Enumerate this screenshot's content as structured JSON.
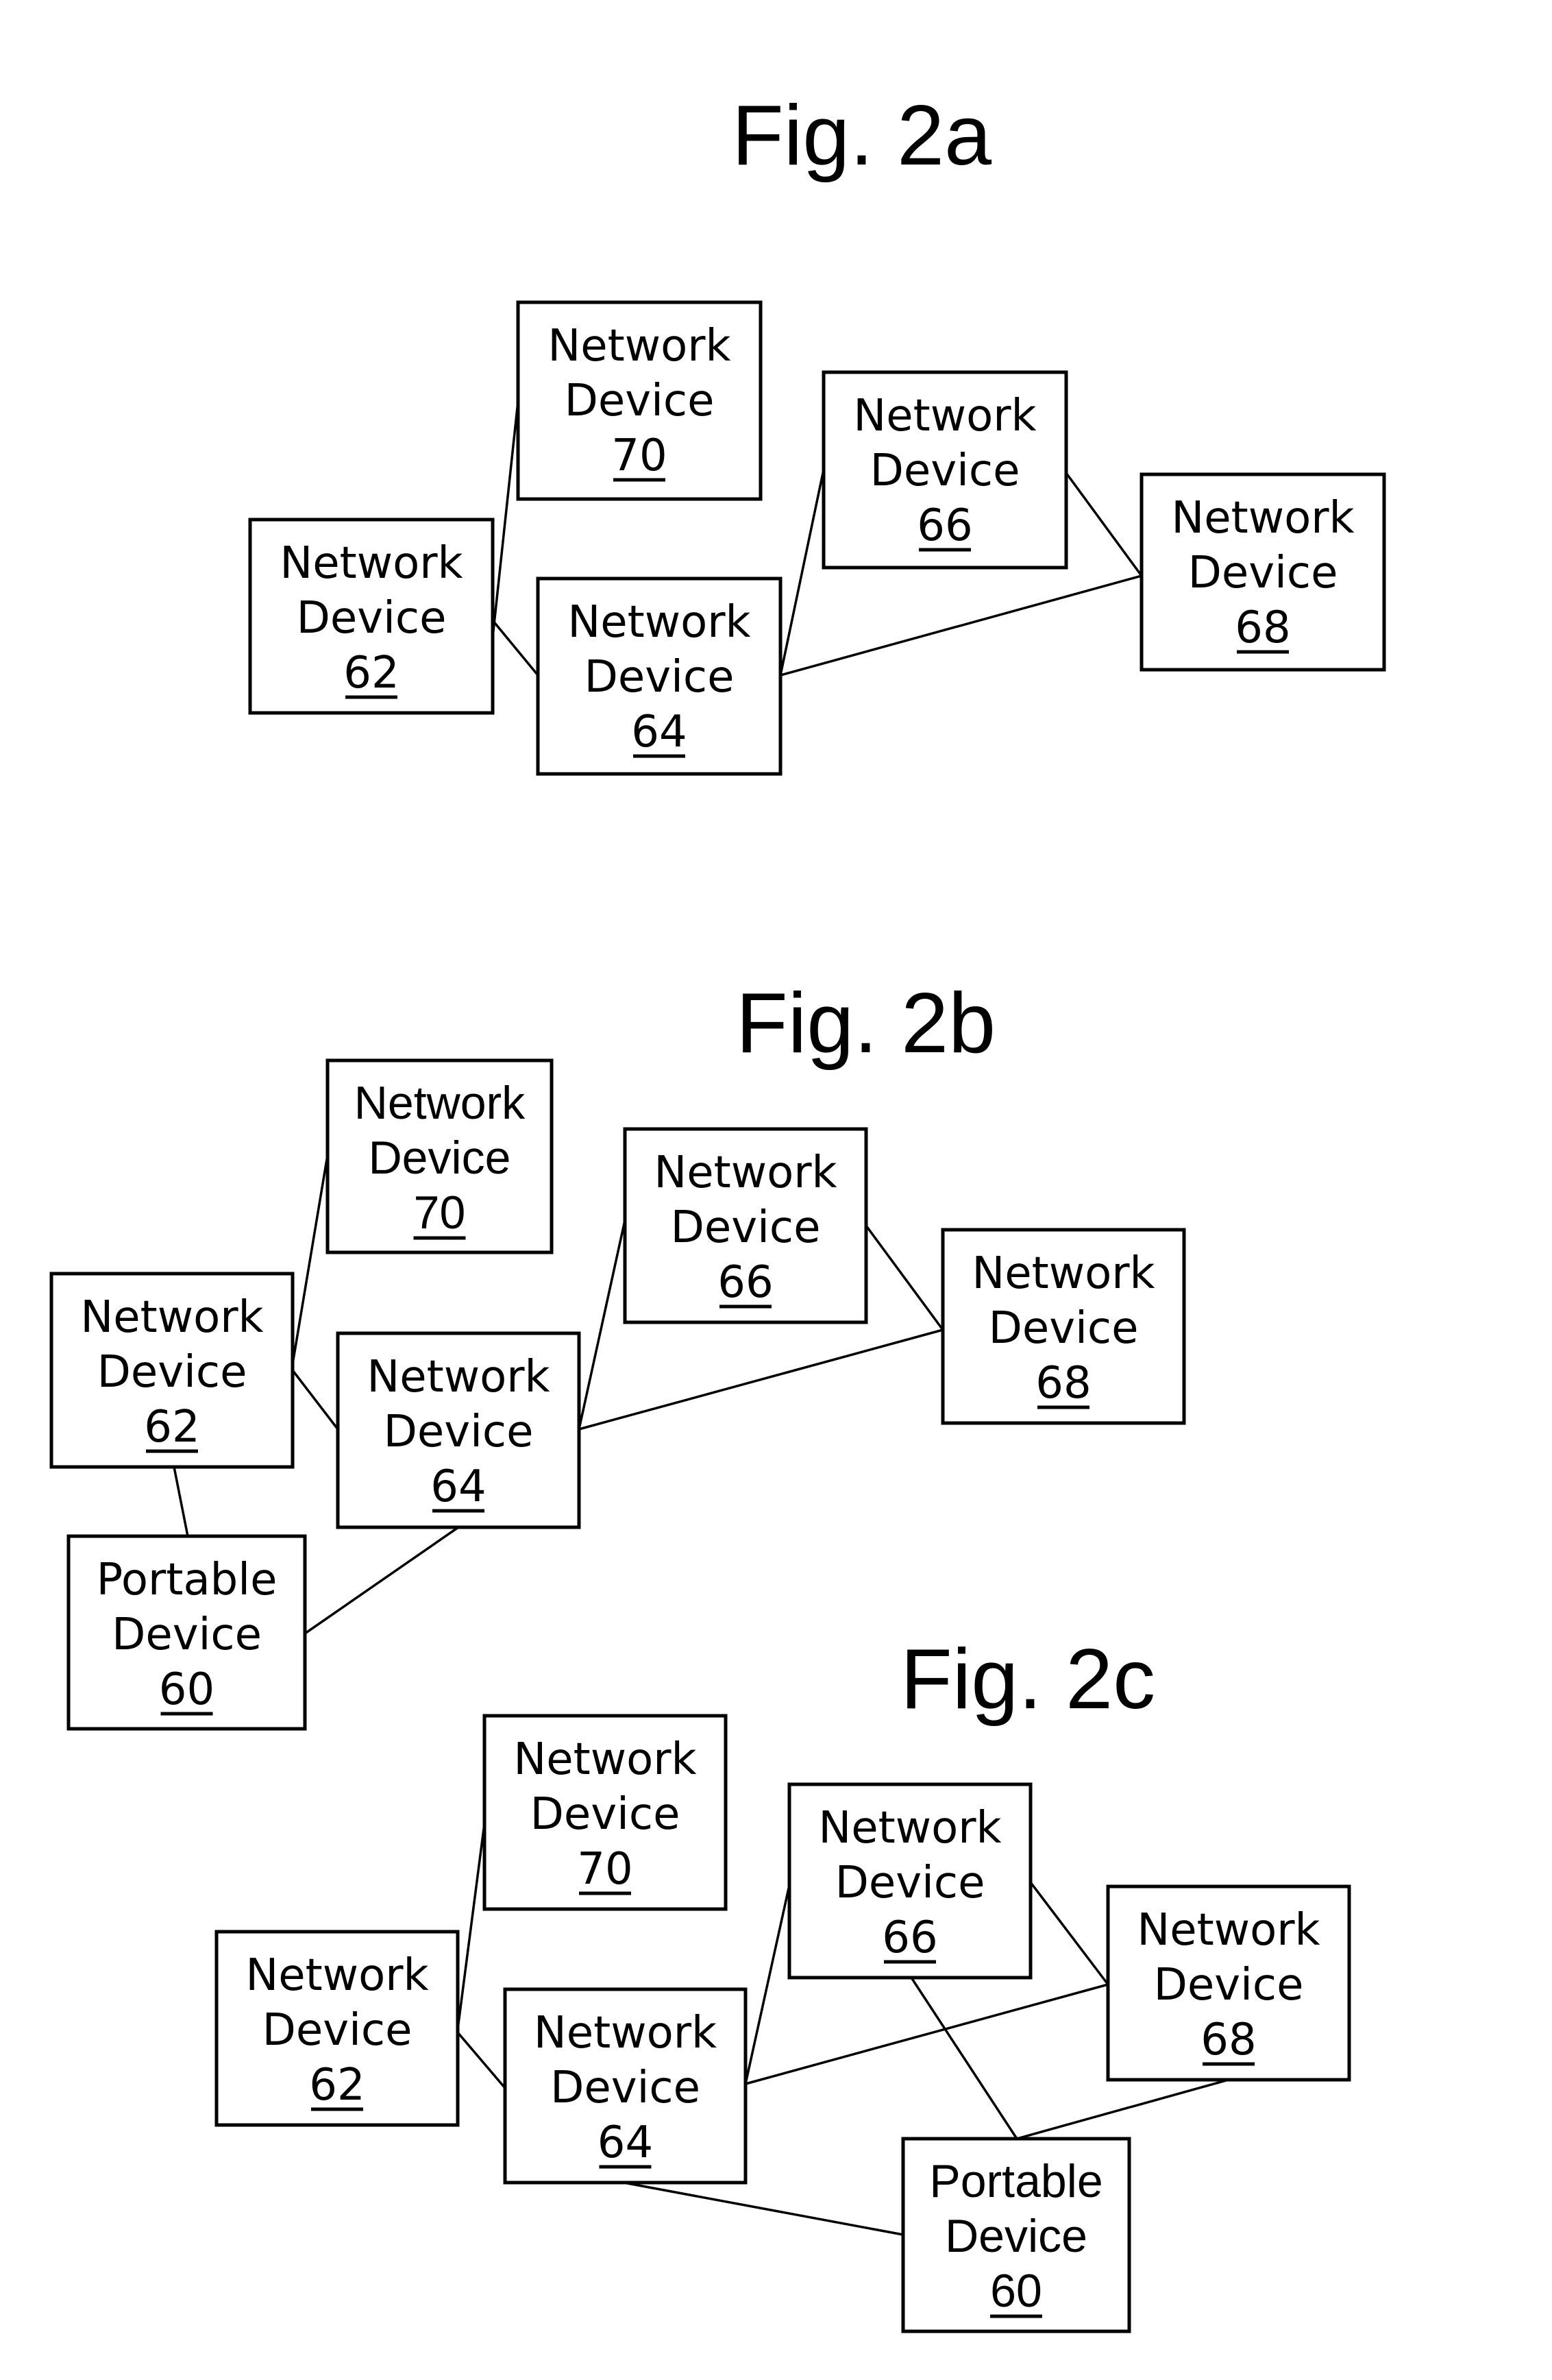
{
  "figures": [
    {
      "id": "2a",
      "title": "Fig. 2a",
      "nodes": [
        {
          "id": "62",
          "line1": "Network",
          "line2": "Device",
          "ref": "62",
          "style": "comic"
        },
        {
          "id": "70",
          "line1": "Network",
          "line2": "Device",
          "ref": "70",
          "style": "comic"
        },
        {
          "id": "64",
          "line1": "Network",
          "line2": "Device",
          "ref": "64",
          "style": "comic"
        },
        {
          "id": "66",
          "line1": "Network",
          "line2": "Device",
          "ref": "66",
          "style": "comic"
        },
        {
          "id": "68",
          "line1": "Network",
          "line2": "Device",
          "ref": "68",
          "style": "comic"
        }
      ],
      "edges": [
        [
          "62",
          "70"
        ],
        [
          "62",
          "64"
        ],
        [
          "64",
          "66"
        ],
        [
          "64",
          "68"
        ],
        [
          "66",
          "68"
        ]
      ]
    },
    {
      "id": "2b",
      "title": "Fig. 2b",
      "nodes": [
        {
          "id": "70",
          "line1": "Network",
          "line2": "Device",
          "ref": "70",
          "style": "sans"
        },
        {
          "id": "66",
          "line1": "Network",
          "line2": "Device",
          "ref": "66",
          "style": "comic"
        },
        {
          "id": "68",
          "line1": "Network",
          "line2": "Device",
          "ref": "68",
          "style": "comic"
        },
        {
          "id": "62",
          "line1": "Network",
          "line2": "Device",
          "ref": "62",
          "style": "comic"
        },
        {
          "id": "64",
          "line1": "Network",
          "line2": "Device",
          "ref": "64",
          "style": "comic"
        },
        {
          "id": "60",
          "line1": "Portable",
          "line2": "Device",
          "ref": "60",
          "style": "comic"
        }
      ],
      "edges": [
        [
          "62",
          "70"
        ],
        [
          "62",
          "64"
        ],
        [
          "64",
          "66"
        ],
        [
          "64",
          "68"
        ],
        [
          "66",
          "68"
        ],
        [
          "62",
          "60"
        ],
        [
          "64",
          "60"
        ]
      ]
    },
    {
      "id": "2c",
      "title": "Fig. 2c",
      "nodes": [
        {
          "id": "70",
          "line1": "Network",
          "line2": "Device",
          "ref": "70",
          "style": "comic"
        },
        {
          "id": "62",
          "line1": "Network",
          "line2": "Device",
          "ref": "62",
          "style": "comic"
        },
        {
          "id": "64",
          "line1": "Network",
          "line2": "Device",
          "ref": "64",
          "style": "comic"
        },
        {
          "id": "66",
          "line1": "Network",
          "line2": "Device",
          "ref": "66",
          "style": "comic"
        },
        {
          "id": "68",
          "line1": "Network",
          "line2": "Device",
          "ref": "68",
          "style": "comic"
        },
        {
          "id": "60",
          "line1": "Portable",
          "line2": "Device",
          "ref": "60",
          "style": "sans"
        }
      ],
      "edges": [
        [
          "62",
          "70"
        ],
        [
          "62",
          "64"
        ],
        [
          "64",
          "66"
        ],
        [
          "64",
          "68"
        ],
        [
          "66",
          "68"
        ],
        [
          "66",
          "60"
        ],
        [
          "68",
          "60"
        ],
        [
          "64",
          "60"
        ]
      ]
    }
  ]
}
